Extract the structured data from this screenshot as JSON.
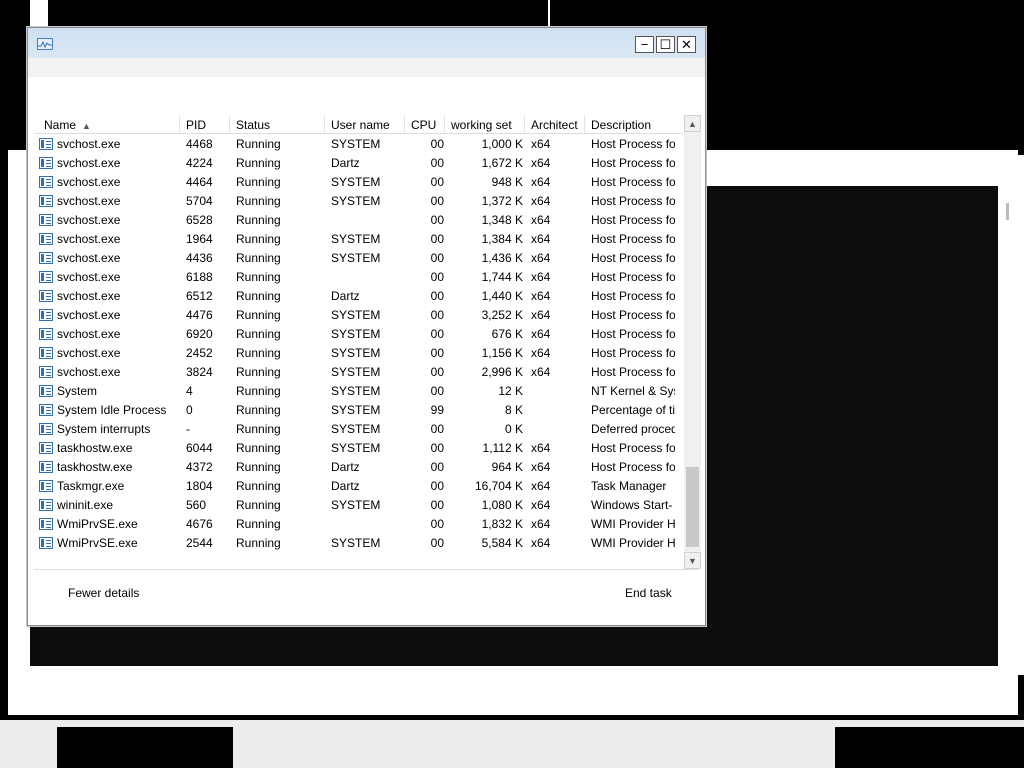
{
  "window": {
    "min_symbol": "−",
    "max_symbol": "☐",
    "close_symbol": "✕",
    "icon": "task-manager-icon"
  },
  "columns": [
    {
      "label": "Name",
      "sorted": "ascending"
    },
    {
      "label": "PID"
    },
    {
      "label": "Status"
    },
    {
      "label": "User name"
    },
    {
      "label": "CPU"
    },
    {
      "label": "working set"
    },
    {
      "label": "Architect"
    },
    {
      "label": "Description"
    }
  ],
  "sort_arrow": "▲",
  "rows": [
    {
      "name": "svchost.exe",
      "pid": "4468",
      "status": "Running",
      "user": "SYSTEM",
      "cpu": "00",
      "ws": "1,000 K",
      "arch": "x64",
      "desc": "Host Process fo",
      "icon": "service-icon"
    },
    {
      "name": "svchost.exe",
      "pid": "4224",
      "status": "Running",
      "user": "Dartz",
      "cpu": "00",
      "ws": "1,672 K",
      "arch": "x64",
      "desc": "Host Process fo",
      "icon": "service-icon"
    },
    {
      "name": "svchost.exe",
      "pid": "4464",
      "status": "Running",
      "user": "SYSTEM",
      "cpu": "00",
      "ws": "948 K",
      "arch": "x64",
      "desc": "Host Process fo",
      "icon": "service-icon"
    },
    {
      "name": "svchost.exe",
      "pid": "5704",
      "status": "Running",
      "user": "SYSTEM",
      "cpu": "00",
      "ws": "1,372 K",
      "arch": "x64",
      "desc": "Host Process fo",
      "icon": "service-icon"
    },
    {
      "name": "svchost.exe",
      "pid": "6528",
      "status": "Running",
      "user": "",
      "cpu": "00",
      "ws": "1,348 K",
      "arch": "x64",
      "desc": "Host Process fo",
      "icon": "service-icon"
    },
    {
      "name": "svchost.exe",
      "pid": "1964",
      "status": "Running",
      "user": "SYSTEM",
      "cpu": "00",
      "ws": "1,384 K",
      "arch": "x64",
      "desc": "Host Process fo",
      "icon": "service-icon"
    },
    {
      "name": "svchost.exe",
      "pid": "4436",
      "status": "Running",
      "user": "SYSTEM",
      "cpu": "00",
      "ws": "1,436 K",
      "arch": "x64",
      "desc": "Host Process fo",
      "icon": "service-icon"
    },
    {
      "name": "svchost.exe",
      "pid": "6188",
      "status": "Running",
      "user": "",
      "cpu": "00",
      "ws": "1,744 K",
      "arch": "x64",
      "desc": "Host Process fo",
      "icon": "service-icon"
    },
    {
      "name": "svchost.exe",
      "pid": "6512",
      "status": "Running",
      "user": "Dartz",
      "cpu": "00",
      "ws": "1,440 K",
      "arch": "x64",
      "desc": "Host Process fo",
      "icon": "service-icon"
    },
    {
      "name": "svchost.exe",
      "pid": "4476",
      "status": "Running",
      "user": "SYSTEM",
      "cpu": "00",
      "ws": "3,252 K",
      "arch": "x64",
      "desc": "Host Process fo",
      "icon": "service-icon"
    },
    {
      "name": "svchost.exe",
      "pid": "6920",
      "status": "Running",
      "user": "SYSTEM",
      "cpu": "00",
      "ws": "676 K",
      "arch": "x64",
      "desc": "Host Process fo",
      "icon": "service-icon"
    },
    {
      "name": "svchost.exe",
      "pid": "2452",
      "status": "Running",
      "user": "SYSTEM",
      "cpu": "00",
      "ws": "1,156 K",
      "arch": "x64",
      "desc": "Host Process fo",
      "icon": "service-icon"
    },
    {
      "name": "svchost.exe",
      "pid": "3824",
      "status": "Running",
      "user": "SYSTEM",
      "cpu": "00",
      "ws": "2,996 K",
      "arch": "x64",
      "desc": "Host Process fo",
      "icon": "service-icon"
    },
    {
      "name": "System",
      "pid": "4",
      "status": "Running",
      "user": "SYSTEM",
      "cpu": "00",
      "ws": "12 K",
      "arch": "",
      "desc": "NT Kernel & Sys",
      "icon": "system-icon"
    },
    {
      "name": "System Idle Process",
      "pid": "0",
      "status": "Running",
      "user": "SYSTEM",
      "cpu": "99",
      "ws": "8 K",
      "arch": "",
      "desc": "Percentage of ti",
      "icon": "system-icon"
    },
    {
      "name": "System interrupts",
      "pid": "-",
      "status": "Running",
      "user": "SYSTEM",
      "cpu": "00",
      "ws": "0 K",
      "arch": "",
      "desc": "Deferred proced",
      "icon": "system-icon"
    },
    {
      "name": "taskhostw.exe",
      "pid": "6044",
      "status": "Running",
      "user": "SYSTEM",
      "cpu": "00",
      "ws": "1,112 K",
      "arch": "x64",
      "desc": "Host Process fo",
      "icon": "service-icon"
    },
    {
      "name": "taskhostw.exe",
      "pid": "4372",
      "status": "Running",
      "user": "Dartz",
      "cpu": "00",
      "ws": "964 K",
      "arch": "x64",
      "desc": "Host Process fo",
      "icon": "service-icon"
    },
    {
      "name": "Taskmgr.exe",
      "pid": "1804",
      "status": "Running",
      "user": "Dartz",
      "cpu": "00",
      "ws": "16,704 K",
      "arch": "x64",
      "desc": "Task Manager",
      "icon": "task-manager-icon"
    },
    {
      "name": "wininit.exe",
      "pid": "560",
      "status": "Running",
      "user": "SYSTEM",
      "cpu": "00",
      "ws": "1,080 K",
      "arch": "x64",
      "desc": "Windows Start-",
      "icon": "service-icon"
    },
    {
      "name": "WmiPrvSE.exe",
      "pid": "4676",
      "status": "Running",
      "user": "",
      "cpu": "00",
      "ws": "1,832 K",
      "arch": "x64",
      "desc": "WMI Provider H",
      "icon": "wmi-icon"
    },
    {
      "name": "WmiPrvSE.exe",
      "pid": "2544",
      "status": "Running",
      "user": "SYSTEM",
      "cpu": "00",
      "ws": "5,584 K",
      "arch": "x64",
      "desc": "WMI Provider H",
      "icon": "wmi-icon"
    }
  ],
  "footer": {
    "fewer_details": "Fewer details",
    "end_task": "End task"
  }
}
